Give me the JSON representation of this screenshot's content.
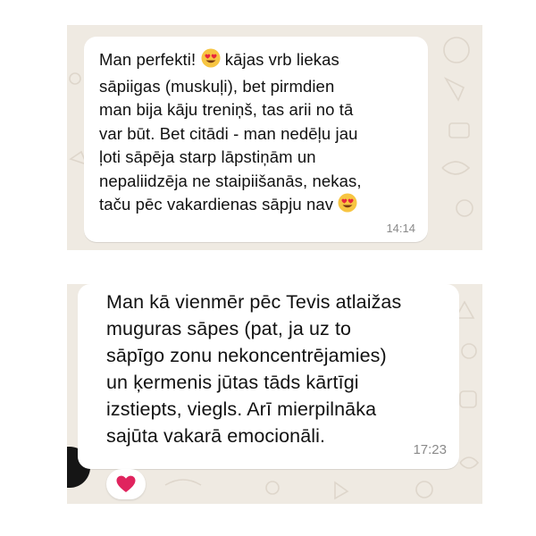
{
  "messages": [
    {
      "line_1": "Man perfekti!",
      "line_1_rest": " kājas vrb liekas",
      "body": "sāpiigas (muskuļi), bet pirmdien\nman bija kāju treniņš, tas arii no tā\nvar būt. Bet citādi - man nedēļu jau\nļoti sāpēja starp lāpstiņām un\nnepaliidzēja ne staipiišanās, nekas,",
      "last_line": "taču pēc vakardienas sāpju nav",
      "emoji": "smiling-face-with-heart-eyes",
      "time": "14:14"
    },
    {
      "body": "Man kā vienmēr pēc Tevis atlaižas\nmuguras sāpes (pat, ja uz to\nsāpīgo zonu nekoncentrējamies)\nun ķermenis jūtas tāds kārtīgi\nizstiepts, viegls. Arī mierpilnāka\nsajūta vakarā emocionāli.",
      "time": "17:23",
      "reaction": "red-heart"
    }
  ],
  "colors": {
    "chat_background": "#efeae2",
    "bubble": "#ffffff",
    "timestamp": "#8a8a8a",
    "heart": "#e0245e",
    "emoji_face": "#f7c542"
  }
}
